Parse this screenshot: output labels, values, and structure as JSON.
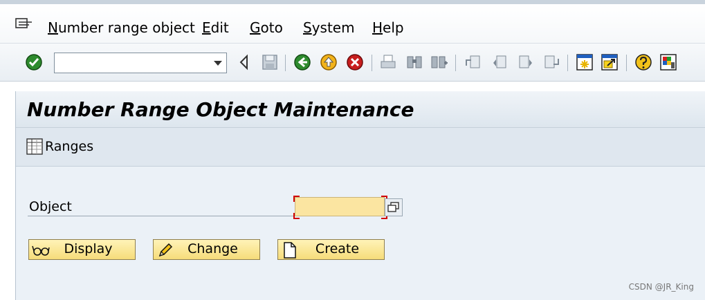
{
  "menubar": {
    "items": [
      {
        "prefix": "N",
        "rest": "umber range object"
      },
      {
        "prefix": "E",
        "rest": "dit"
      },
      {
        "prefix": "G",
        "rest": "oto"
      },
      {
        "prefix": "S",
        "rest": "ystem"
      },
      {
        "prefix": "H",
        "rest": "elp"
      }
    ]
  },
  "toolbar": {
    "command_field_value": "",
    "icons": [
      "enter-check-icon",
      "back-triangle-icon",
      "save-icon",
      "back-icon",
      "exit-icon",
      "cancel-icon",
      "print-icon",
      "find-icon",
      "find-next-icon",
      "first-page-icon",
      "previous-page-icon",
      "next-page-icon",
      "last-page-icon",
      "new-session-icon",
      "shortcut-icon",
      "help-icon",
      "customize-layout-icon"
    ]
  },
  "screen": {
    "title": "Number Range Object Maintenance",
    "ranges_label": "Ranges",
    "object_label": "Object",
    "object_value": "",
    "buttons": {
      "display": "Display",
      "change": "Change",
      "create": "Create"
    }
  },
  "watermark": "CSDN @JR_King",
  "colors": {
    "required_field": "#fbe5a1",
    "button_fill": "#f6dc7a",
    "panel_bg": "#ebf1f7"
  }
}
